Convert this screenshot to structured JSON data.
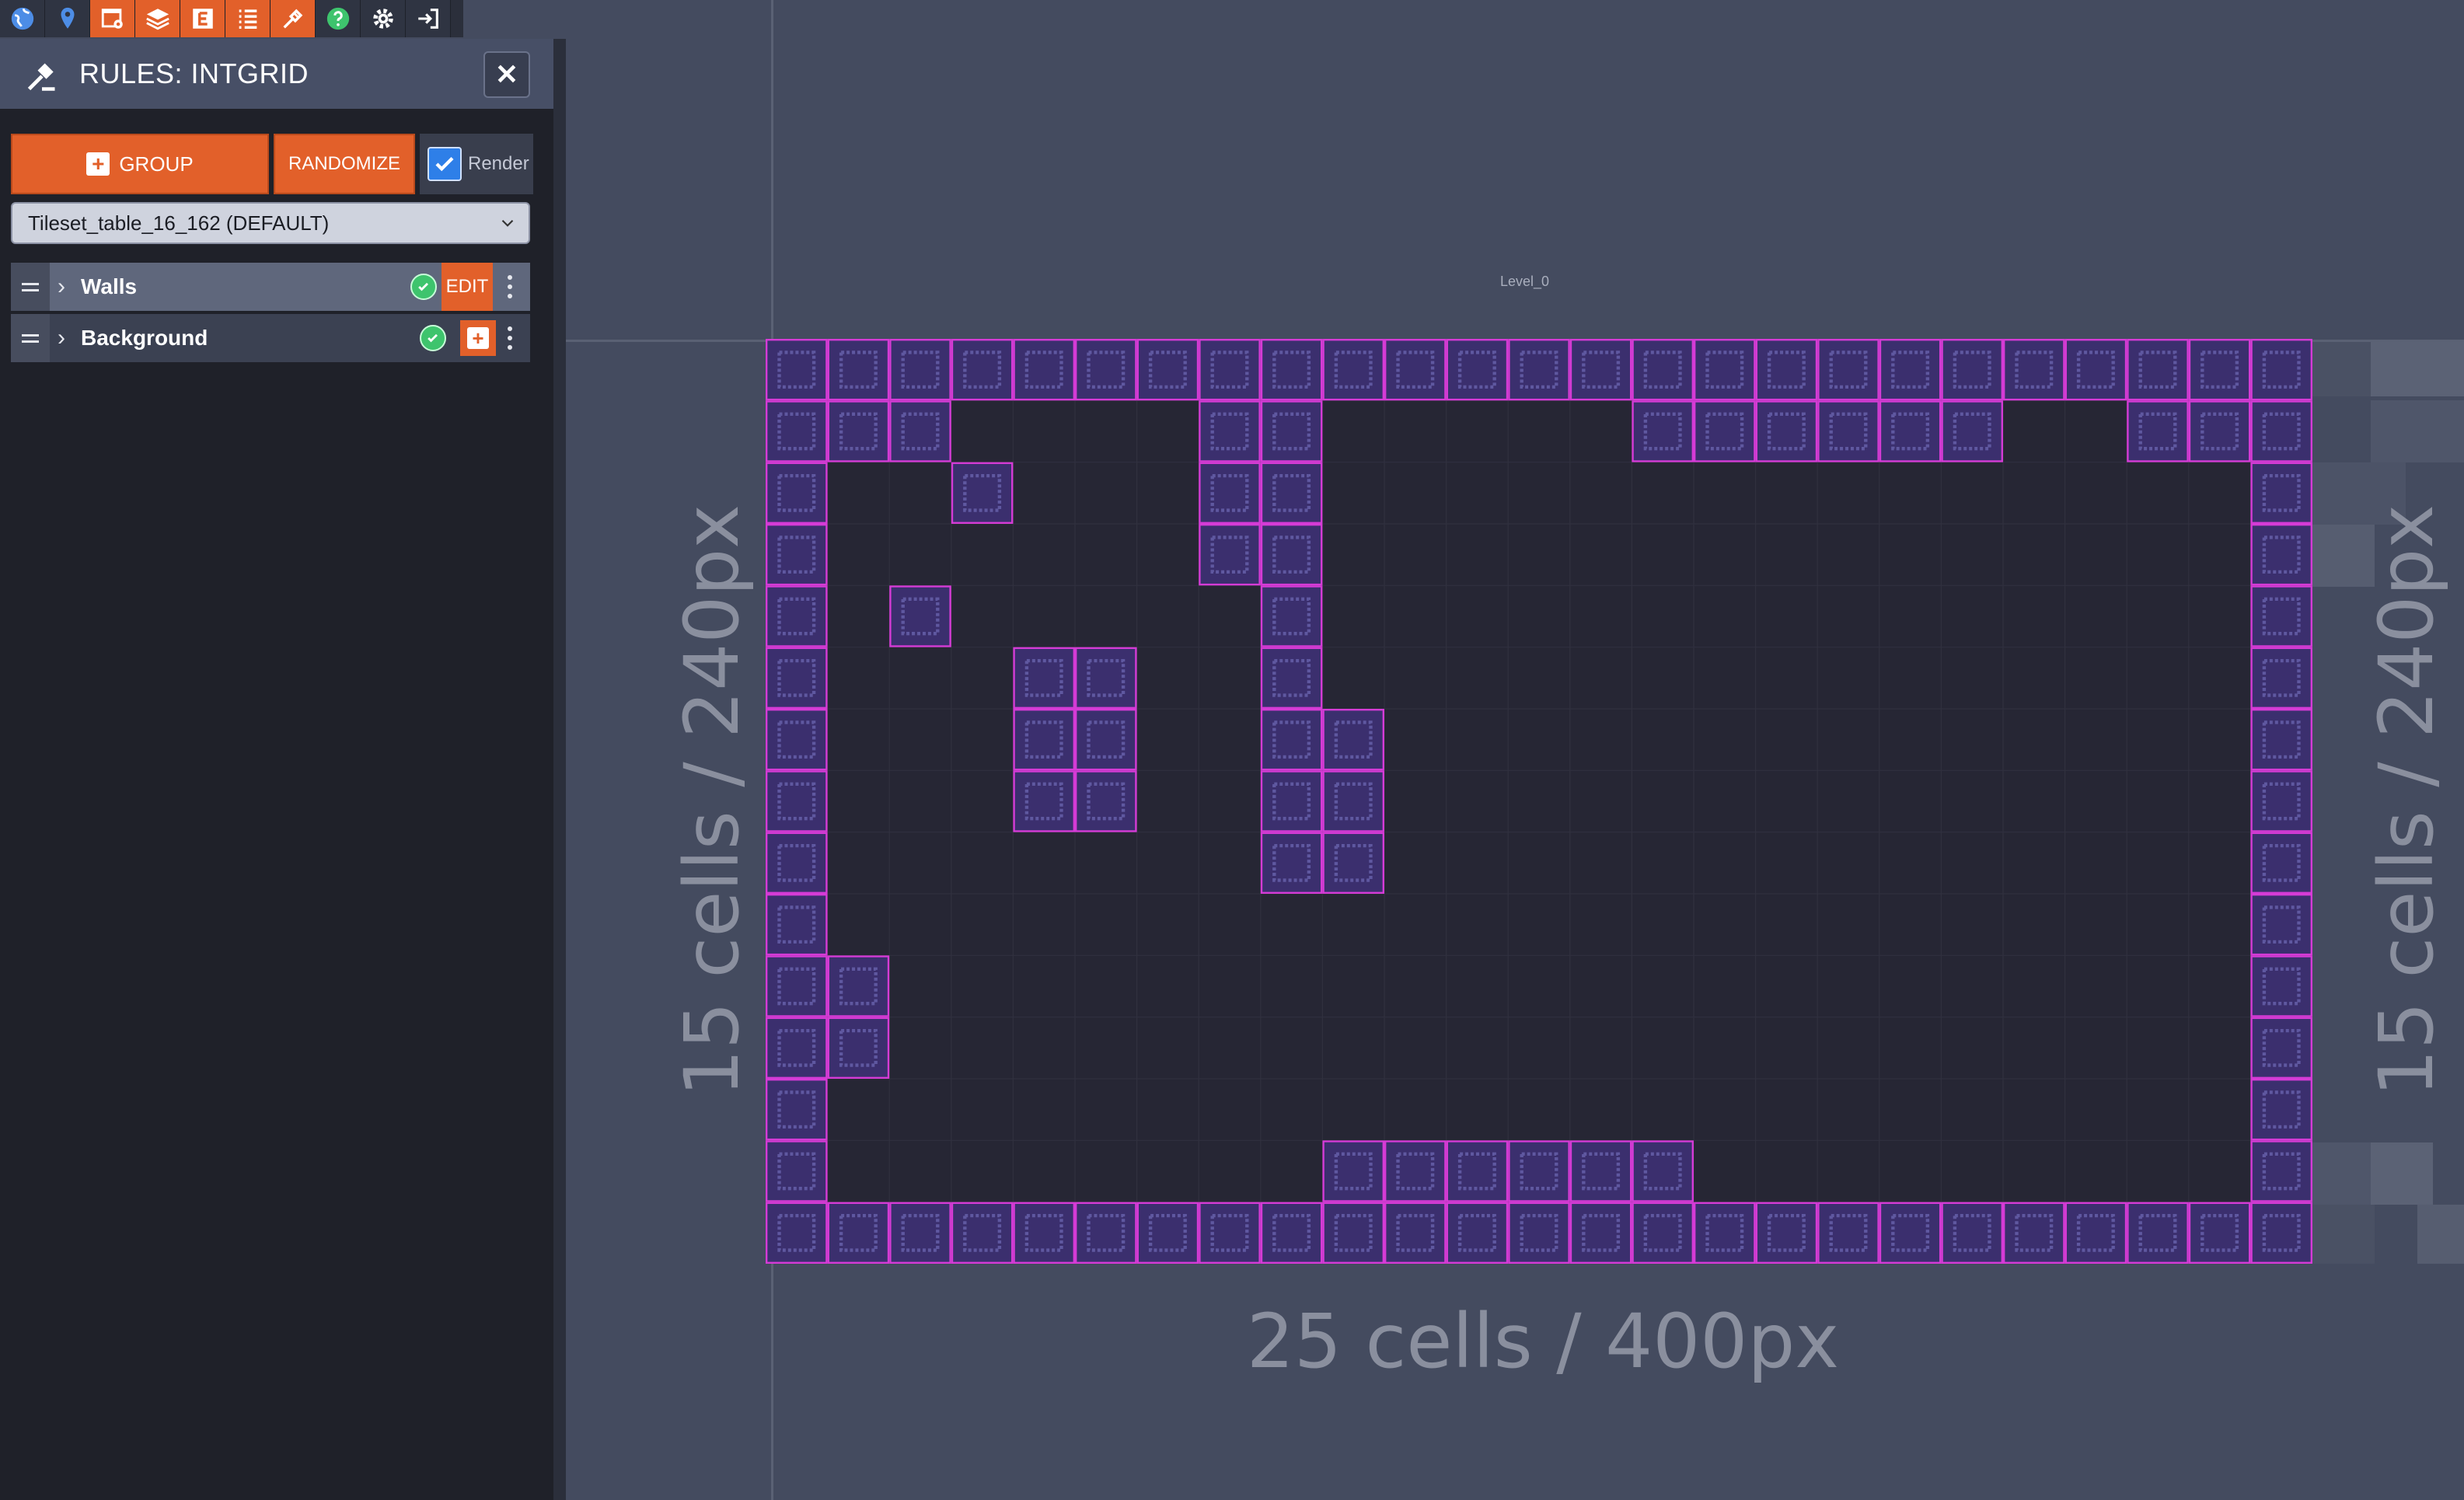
{
  "toolbar": {
    "icons": [
      "world-icon",
      "pin-icon",
      "project-settings-icon",
      "layers-icon",
      "entities-icon",
      "list-icon",
      "rules-icon",
      "help-icon",
      "settings-icon",
      "exit-icon"
    ]
  },
  "panel": {
    "title": "RULES: INTGRID",
    "close_label": "✕",
    "group_label": "GROUP",
    "randomize_label": "RANDOMIZE",
    "render_label": "Render",
    "render_checked": true,
    "tileset_value": "Tileset_table_16_162 (DEFAULT)",
    "rule_groups": [
      {
        "label": "Walls",
        "action_label": "EDIT"
      },
      {
        "label": "Background"
      }
    ]
  },
  "level": {
    "name": "Level_0",
    "width_label": "25 cells / 400px",
    "height_label": "15 cells / 240px",
    "cols": 25,
    "rows": 15
  },
  "colors": {
    "accent": "#e2602a",
    "wall_fill": "#3b2f6e",
    "wall_outline": "#d53bd6",
    "level_bg": "#262634"
  }
}
